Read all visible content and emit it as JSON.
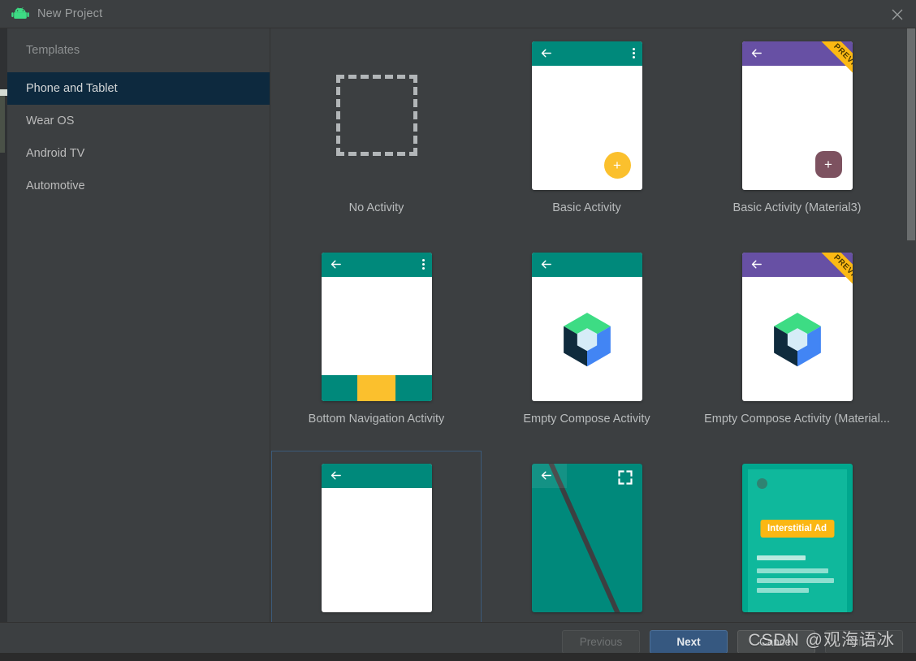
{
  "window": {
    "title": "New Project",
    "app_icon": "android-robot-icon",
    "close_icon": "close-icon"
  },
  "sidebar": {
    "header": "Templates",
    "items": [
      {
        "label": "Phone and Tablet",
        "selected": true
      },
      {
        "label": "Wear OS",
        "selected": false
      },
      {
        "label": "Android TV",
        "selected": false
      },
      {
        "label": "Automotive",
        "selected": false
      }
    ]
  },
  "gallery": {
    "templates": [
      {
        "label": "No Activity",
        "thumb": "dashed-box",
        "selected": false
      },
      {
        "label": "Basic Activity",
        "thumb": "basic",
        "selected": false
      },
      {
        "label": "Basic Activity (Material3)",
        "thumb": "basic-m3",
        "badge": "PREVIEW",
        "selected": false
      },
      {
        "label": "Bottom Navigation Activity",
        "thumb": "bottom-nav",
        "selected": false
      },
      {
        "label": "Empty Compose Activity",
        "thumb": "compose",
        "selected": false
      },
      {
        "label": "Empty Compose Activity (Material...",
        "thumb": "compose-m3",
        "badge": "PREVIEW",
        "selected": false
      },
      {
        "label": "",
        "thumb": "empty-activity",
        "selected": true
      },
      {
        "label": "",
        "thumb": "fullscreen",
        "selected": false
      },
      {
        "label": "",
        "thumb": "admob",
        "selected": false
      }
    ],
    "admob_badge_text": "Interstitial Ad",
    "scrollbar": "vertical-scrollbar"
  },
  "footer": {
    "previous_label": "Previous",
    "next_label": "Next",
    "cancel_label": "Cancel",
    "finish_label": "Finish"
  },
  "watermark": "CSDN @观海语冰",
  "colors": {
    "background": "#3c3f41",
    "selection": "#0d293e",
    "teal": "#00897b",
    "purple": "#673ab7",
    "amber": "#fbc02d",
    "primary_button": "#365880",
    "ribbon": "#fcb913"
  }
}
